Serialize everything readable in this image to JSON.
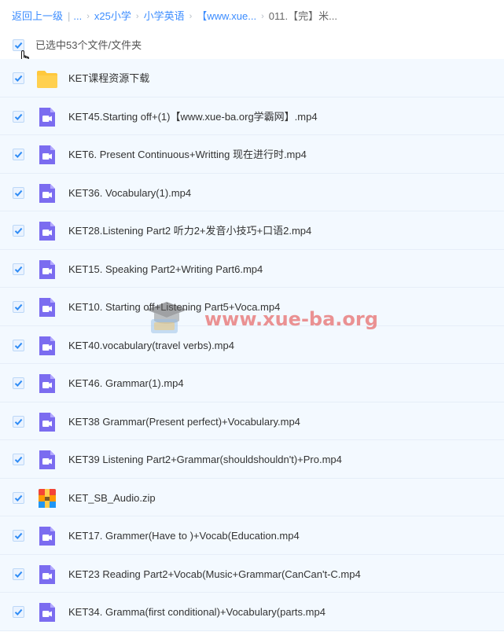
{
  "breadcrumb": {
    "back": "返回上一级",
    "ellipsis": "...",
    "items": [
      "x25小学",
      "小学英语",
      "【www.xue...",
      "011.【完】米..."
    ]
  },
  "selection": {
    "text": "已选中53个文件/文件夹",
    "checked": true
  },
  "files": [
    {
      "name": "KET课程资源下载",
      "type": "folder-icon"
    },
    {
      "name": "KET45.Starting off+(1)【www.xue-ba.org学霸网】.mp4",
      "type": "video-icon"
    },
    {
      "name": "KET6. Present Continuous+Writting 现在进行时.mp4",
      "type": "video-icon"
    },
    {
      "name": "KET36. Vocabulary(1).mp4",
      "type": "video-icon"
    },
    {
      "name": "KET28.Listening Part2 听力2+发音小技巧+口语2.mp4",
      "type": "video-icon"
    },
    {
      "name": "KET15. Speaking Part2+Writing Part6.mp4",
      "type": "video-icon"
    },
    {
      "name": "KET10. Starting off+Listening Part5+Voca.mp4",
      "type": "video-icon"
    },
    {
      "name": "KET40.vocabulary(travel verbs).mp4",
      "type": "video-icon"
    },
    {
      "name": "KET46. Grammar(1).mp4",
      "type": "video-icon"
    },
    {
      "name": "KET38 Grammar(Present perfect)+Vocabulary.mp4",
      "type": "video-icon"
    },
    {
      "name": "KET39 Listening Part2+Grammar(shouldshouldn't)+Pro.mp4",
      "type": "video-icon"
    },
    {
      "name": "KET_SB_Audio.zip",
      "type": "zip-icon"
    },
    {
      "name": "KET17. Grammer(Have to )+Vocab(Education.mp4",
      "type": "video-icon"
    },
    {
      "name": "KET23 Reading Part2+Vocab(Music+Grammar(CanCan't-C.mp4",
      "type": "video-icon"
    },
    {
      "name": "KET34. Gramma(first conditional)+Vocabulary(parts.mp4",
      "type": "video-icon"
    }
  ],
  "watermark": {
    "text": "www.xue-ba.org"
  },
  "colors": {
    "link": "#3b8cff",
    "row_bg": "#f3f9ff",
    "check": "#2f8cf5",
    "video": "#7b6cf0",
    "folder": "#ffc83d"
  }
}
